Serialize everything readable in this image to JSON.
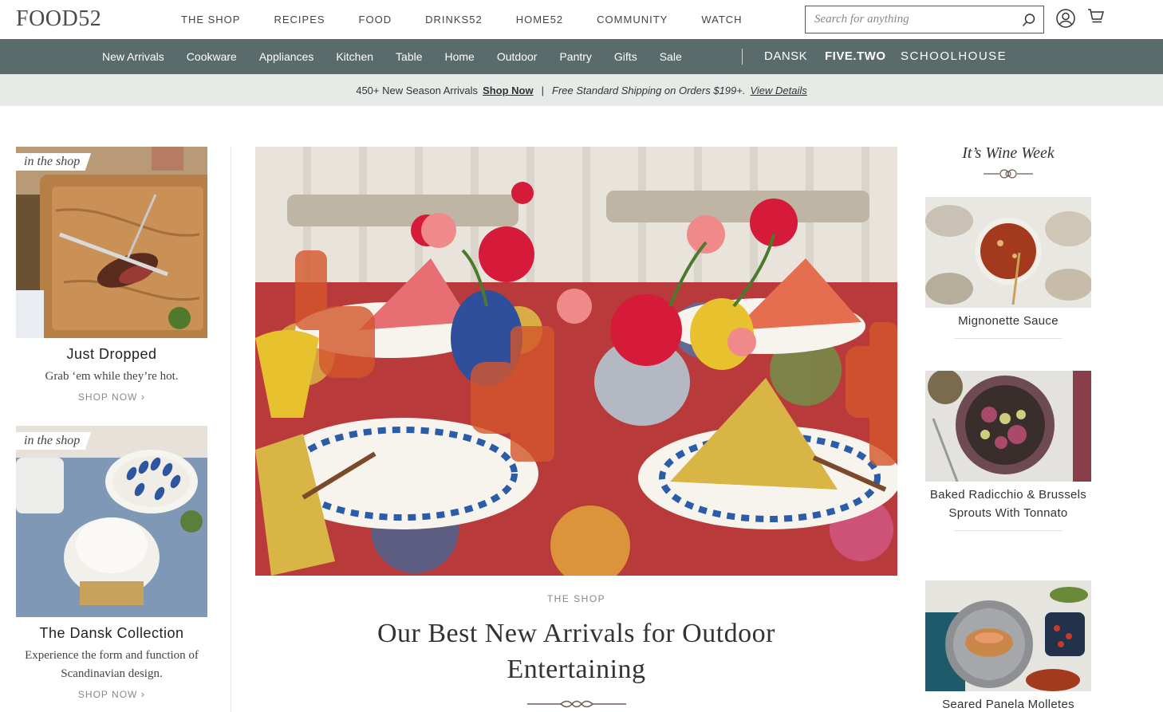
{
  "header": {
    "logo": "FOOD52",
    "nav": [
      "THE SHOP",
      "RECIPES",
      "FOOD",
      "DRINKS52",
      "HOME52",
      "COMMUNITY",
      "WATCH"
    ],
    "search_placeholder": "Search for anything",
    "icons": [
      "search-icon",
      "user-icon",
      "cart-icon"
    ]
  },
  "subnav": {
    "items": [
      "New Arrivals",
      "Cookware",
      "Appliances",
      "Kitchen",
      "Table",
      "Home",
      "Outdoor",
      "Pantry",
      "Gifts",
      "Sale"
    ],
    "brands": [
      "DANSK",
      "FIVE.TWO",
      "SCHOOLHOUSE"
    ]
  },
  "promo": {
    "text1": "450+ New Season Arrivals",
    "link1": "Shop Now",
    "separator": "|",
    "text2": "Free Standard Shipping on Orders $199+.",
    "link2": "View Details"
  },
  "left": {
    "cards": [
      {
        "tag": "in the shop",
        "title": "Just Dropped",
        "desc": "Grab ‘em while they’re hot.",
        "cta": "SHOP NOW"
      },
      {
        "tag": "in the shop",
        "title": "The Dansk Collection",
        "desc": "Experience the form and function of Scandinavian design.",
        "cta": "SHOP NOW"
      }
    ]
  },
  "hero": {
    "kicker": "THE SHOP",
    "title": "Our Best New Arrivals for Outdoor Entertaining"
  },
  "right": {
    "title": "It’s Wine Week",
    "items": [
      {
        "title": "Mignonette Sauce"
      },
      {
        "title": "Baked Radicchio & Brussels Sprouts With Tonnato"
      },
      {
        "title": "Seared Panela Molletes"
      }
    ]
  },
  "colors": {
    "subnav_bg": "#5a6b6b",
    "promo_bg": "#e6ebe8"
  }
}
